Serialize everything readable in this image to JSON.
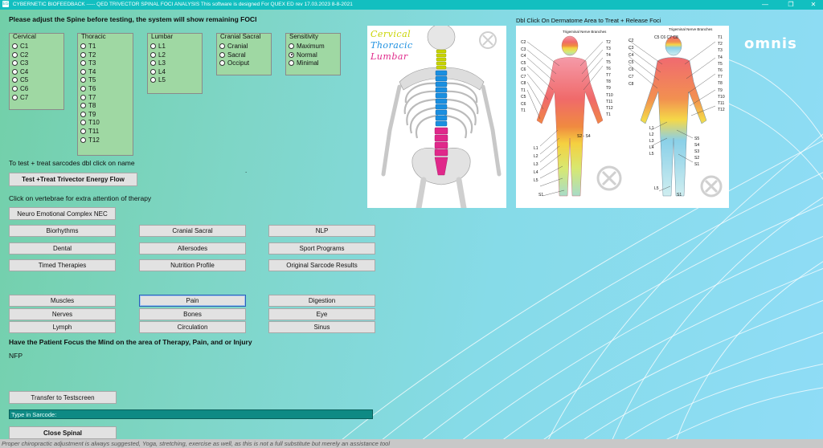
{
  "window": {
    "icon": "EG",
    "title": "CYBERNETIC BIOFEEDBACK   -----   QED    TRIVECTOR SPINAL FOCI ANALYSIS   This software is designed For QUEX ED rev 17.03.2023 8-8-2021",
    "min": "—",
    "max": "❐",
    "close": "✕"
  },
  "header": {
    "instruction": "Please adjust the Spine before testing, the system will show remaining FOCI"
  },
  "groups": {
    "cervical": {
      "label": "Cervical",
      "items": [
        "C1",
        "C2",
        "C3",
        "C4",
        "C5",
        "C6",
        "C7"
      ]
    },
    "thoracic": {
      "label": "Thoracic",
      "items": [
        "T1",
        "T2",
        "T3",
        "T4",
        "T5",
        "T6",
        "T7",
        "T8",
        "T9",
        "T10",
        "T11",
        "T12"
      ]
    },
    "lumbar": {
      "label": "Lumbar",
      "items": [
        "L1",
        "L2",
        "L3",
        "L4",
        "L5"
      ]
    },
    "cranial": {
      "label": "Cranial Sacral",
      "items": [
        "Cranial",
        "Sacral",
        "Occiput"
      ]
    },
    "sensitivity": {
      "label": "Sensitivity",
      "items": [
        "Maximum",
        "Normal",
        "Minimal"
      ],
      "selected": "Normal"
    }
  },
  "texts": {
    "test_treat_hint": "To test + treat sarcodes dbl click on name",
    "vertebrae_hint": "Click on vertebrae for extra attention of therapy",
    "focus_hint": "Have the Patient Focus the Mind on the area of Therapy, Pain, and or Injury",
    "nfp": "NFP",
    "dermatome_hint": "Dbl Click On Dermatome Area to Treat + Release Foci",
    "dot": "."
  },
  "buttons": {
    "test_treat": "Test +Treat Trivector Energy Flow",
    "nec": "Neuro Emotional Complex NEC",
    "biorhythms": "Biorhythms",
    "cranial_sacral": "Cranial Sacral",
    "nlp": "NLP",
    "dental": "Dental",
    "allersodes": "Allersodes",
    "sport": "Sport Programs",
    "timed": "Timed Therapies",
    "nutrition": "Nutrition Profile",
    "original": "Original Sarcode Results",
    "muscles": "Muscles",
    "pain": "Pain",
    "digestion": "Digestion",
    "nerves": "Nerves",
    "bones": "Bones",
    "eye": "Eye",
    "lymph": "Lymph",
    "circulation": "Circulation",
    "sinus": "Sinus",
    "transfer": "Transfer to Testscreen",
    "close_spinal": "Close Spinal"
  },
  "sarcode": {
    "value": "Type in Sarcode:"
  },
  "spine_image": {
    "cervical": "Cervical",
    "thoracic": "Thoracic",
    "lumbar": "Lumbar"
  },
  "dermatome": {
    "trigeminal": "Trigeminal Nerve Branches",
    "front_left": [
      "C2",
      "C3",
      "C4",
      "C5",
      "C6",
      "C7",
      "C8",
      "T1",
      "C5",
      "C6",
      "T1"
    ],
    "front_right": [
      "T2",
      "T3",
      "T4",
      "T5",
      "T6",
      "T7",
      "T8",
      "T9",
      "T10",
      "T11",
      "T12",
      "T1"
    ],
    "front_bottom": [
      "S2 - S4",
      "L1",
      "L2",
      "L3",
      "L4",
      "L5",
      "S1"
    ],
    "back_top": "C5 C6 C7 C8",
    "back_left": [
      "C2",
      "C3",
      "C4",
      "C5",
      "C6",
      "C7",
      "C8"
    ],
    "back_right": [
      "T1",
      "T2",
      "T3",
      "T4",
      "T5",
      "T6",
      "T7",
      "T8",
      "T9",
      "T10",
      "T11",
      "T12"
    ],
    "back_bottom": [
      "L1",
      "L2",
      "L3",
      "L4",
      "L5",
      "S5",
      "S4",
      "S3",
      "S2",
      "S1",
      "L5",
      "S1"
    ]
  },
  "logo": "omnis",
  "status": {
    "text": "Proper chiropractic adjustment is always suggested, Yoga, stretching, exercise as well, as this is not a full substitute but merely an assistance tool"
  },
  "colors": {
    "titlebar": "#12bfc0",
    "group_bg": "#9fd8a3",
    "input_bg": "#0e8a84",
    "cervical": "#c8d400",
    "thoracic": "#1a8fe0",
    "lumbar": "#e0288a"
  }
}
